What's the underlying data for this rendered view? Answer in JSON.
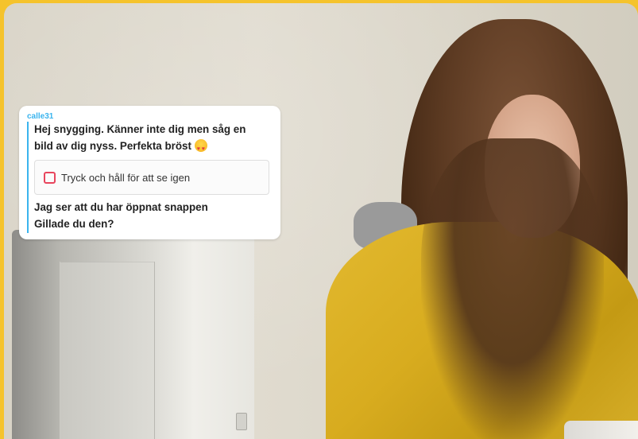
{
  "chat": {
    "sender": "calle31",
    "message_1_line_1": "Hej snygging. Känner inte dig men såg en",
    "message_1_line_2": "bild av dig nyss. Perfekta bröst",
    "message_1_emoji": "heart-eyes-emoji",
    "snap_label": "Tryck och håll för att se igen",
    "message_2_line_1": "Jag ser att du har öppnat snappen",
    "message_2_line_2": "Gillade du den?"
  },
  "colors": {
    "frame": "#f5c32c",
    "sender": "#3ab4ee",
    "snap_icon": "#e8455d"
  }
}
